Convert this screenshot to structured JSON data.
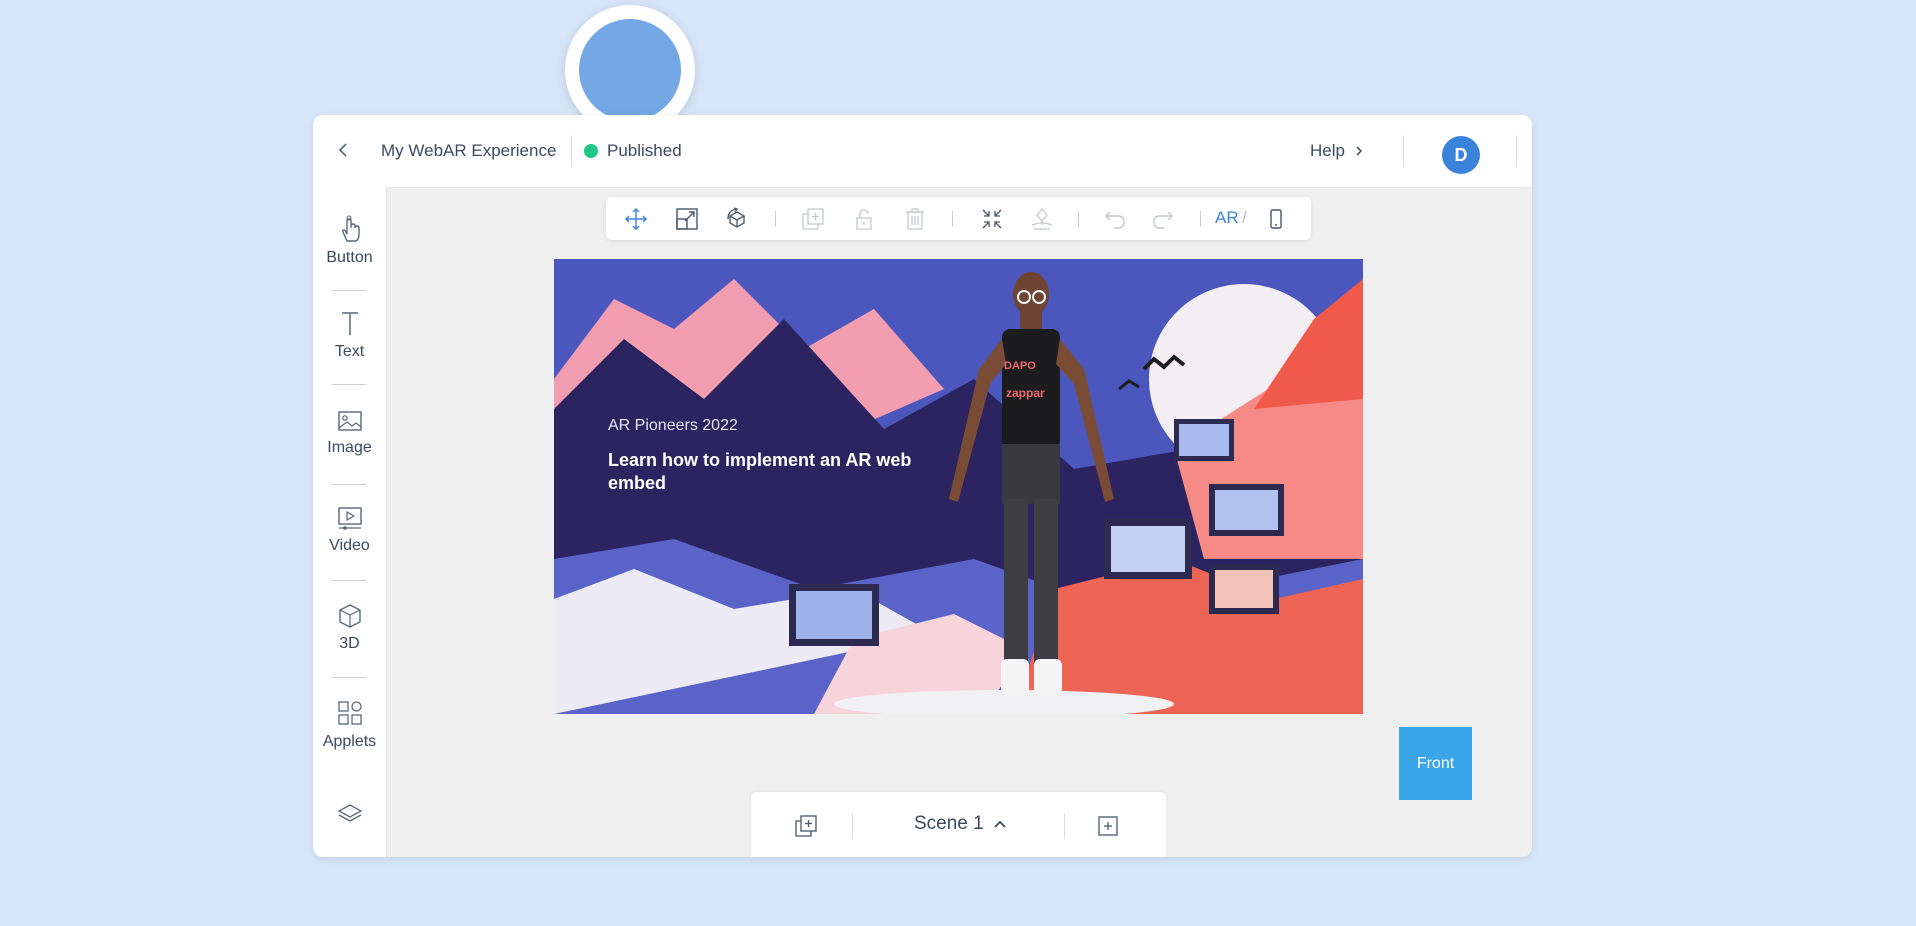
{
  "header": {
    "project_title": "My WebAR Experience",
    "status_label": "Published",
    "status_color": "#20c685",
    "help_label": "Help",
    "avatar_initial": "D"
  },
  "sidebar": {
    "items": [
      {
        "label": "Button",
        "icon": "hand-pointer-icon"
      },
      {
        "label": "Text",
        "icon": "text-icon"
      },
      {
        "label": "Image",
        "icon": "image-icon"
      },
      {
        "label": "Video",
        "icon": "video-icon"
      },
      {
        "label": "3D",
        "icon": "cube-icon"
      },
      {
        "label": "Applets",
        "icon": "applets-icon"
      }
    ],
    "layers_icon": "layers-icon"
  },
  "toolbar": {
    "ar_label": "AR",
    "slash": "/",
    "tools": [
      "move-icon",
      "scale-icon",
      "rotate-icon",
      "duplicate-icon",
      "lock-icon",
      "delete-icon",
      "collapse-icon",
      "anchor-icon",
      "undo-icon",
      "redo-icon",
      "phone-icon"
    ]
  },
  "canvas": {
    "subtitle": "AR Pioneers 2022",
    "headline": "Learn how to implement an AR web embed",
    "shirt_text": "DAPO",
    "shirt_brand": "zappar"
  },
  "front_button_label": "Front",
  "scene": {
    "name": "Scene 1"
  },
  "colors": {
    "accent": "#3b82db",
    "front_button": "#3ba5e9",
    "background": "#d6e5f7"
  }
}
